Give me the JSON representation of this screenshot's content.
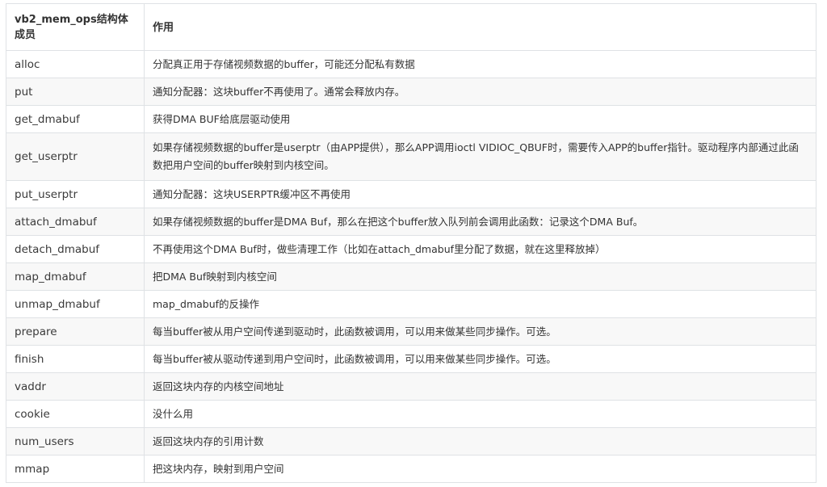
{
  "table": {
    "headers": [
      "vb2_mem_ops结构体成员",
      "作用"
    ],
    "rows": [
      {
        "member": "alloc",
        "desc": "分配真正用于存储视频数据的buffer，可能还分配私有数据"
      },
      {
        "member": "put",
        "desc": "通知分配器：这块buffer不再使用了。通常会释放内存。"
      },
      {
        "member": "get_dmabuf",
        "desc": "获得DMA BUF给底层驱动使用"
      },
      {
        "member": "get_userptr",
        "desc": "如果存储视频数据的buffer是userptr（由APP提供），那么APP调用ioctl VIDIOC_QBUF时，需要传入APP的buffer指针。驱动程序内部通过此函数把用户空间的buffer映射到内核空间。"
      },
      {
        "member": "put_userptr",
        "desc": "通知分配器：这块USERPTR缓冲区不再使用"
      },
      {
        "member": "attach_dmabuf",
        "desc": "如果存储视频数据的buffer是DMA Buf，那么在把这个buffer放入队列前会调用此函数：记录这个DMA Buf。"
      },
      {
        "member": "detach_dmabuf",
        "desc": "不再使用这个DMA Buf时，做些清理工作（比如在attach_dmabuf里分配了数据，就在这里释放掉）"
      },
      {
        "member": "map_dmabuf",
        "desc": "把DMA Buf映射到内核空间"
      },
      {
        "member": "unmap_dmabuf",
        "desc": "map_dmabuf的反操作"
      },
      {
        "member": "prepare",
        "desc": "每当buffer被从用户空间传递到驱动时，此函数被调用，可以用来做某些同步操作。可选。"
      },
      {
        "member": "finish",
        "desc": "每当buffer被从驱动传递到用户空间时，此函数被调用，可以用来做某些同步操作。可选。"
      },
      {
        "member": "vaddr",
        "desc": "返回这块内存的内核空间地址"
      },
      {
        "member": "cookie",
        "desc": "没什么用"
      },
      {
        "member": "num_users",
        "desc": "返回这块内存的引用计数"
      },
      {
        "member": "mmap",
        "desc": "把这块内存，映射到用户空间"
      }
    ]
  }
}
